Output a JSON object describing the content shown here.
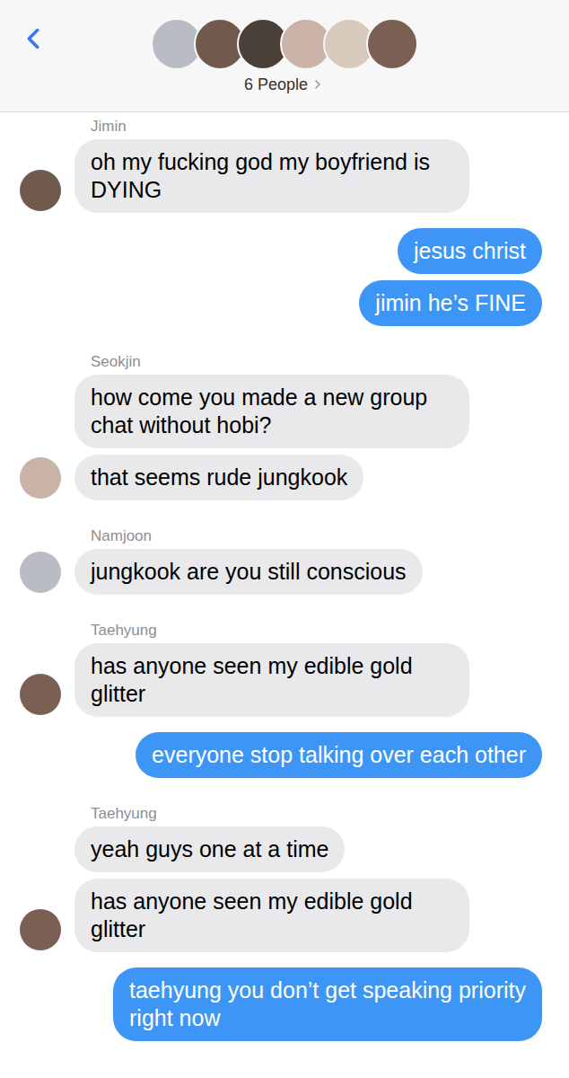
{
  "header": {
    "avatars": [
      {
        "color": "#b9bcc4"
      },
      {
        "color": "#6f5a4c"
      },
      {
        "color": "#4a4038"
      },
      {
        "color": "#c9b2a6"
      },
      {
        "color": "#d8c9bd"
      },
      {
        "color": "#7a5f52"
      }
    ],
    "label": "6 People"
  },
  "groups": [
    {
      "kind": "received",
      "sender": "Jimin",
      "avatar_color": "#6f5a4c",
      "bubbles": [
        "oh my fucking god my boyfriend is DYING"
      ]
    },
    {
      "kind": "sent",
      "bubbles": [
        "jesus christ",
        "jimin he’s FINE"
      ]
    },
    {
      "kind": "received",
      "sender": "Seokjin",
      "avatar_color": "#c9b2a6",
      "bubbles": [
        "how come you made a new group chat without hobi?",
        "that seems rude jungkook"
      ]
    },
    {
      "kind": "received",
      "sender": "Namjoon",
      "avatar_color": "#b9bcc4",
      "bubbles": [
        "jungkook are you still conscious"
      ]
    },
    {
      "kind": "received",
      "sender": "Taehyung",
      "avatar_color": "#7a5f52",
      "bubbles": [
        "has anyone seen my edible gold glitter"
      ]
    },
    {
      "kind": "sent",
      "bubbles": [
        "everyone stop talking over each other"
      ]
    },
    {
      "kind": "received",
      "sender": "Taehyung",
      "avatar_color": "#7a5f52",
      "bubbles": [
        "yeah guys one at a time",
        "has anyone seen my edible gold glitter"
      ]
    },
    {
      "kind": "sent",
      "bubbles": [
        "taehyung you don’t get speaking priority right now"
      ]
    }
  ]
}
